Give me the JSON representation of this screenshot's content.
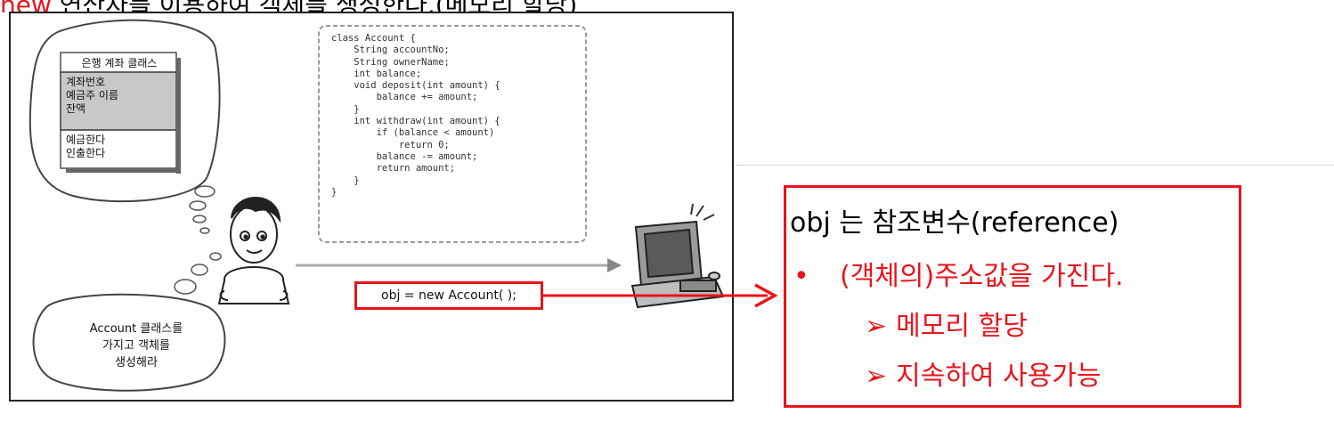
{
  "header_fragment": {
    "lead": "new",
    "rest": " 연산자를 이용하여 객체를 생성한다.(메모리 할당)"
  },
  "figure": {
    "class_box": {
      "title": "은행 계좌 클래스",
      "fields": [
        "계좌번호",
        "예금주 이름",
        "잔액"
      ],
      "methods": [
        "예금한다",
        "인출한다"
      ]
    },
    "code_lines": [
      "class Account {",
      "    String accountNo;",
      "    String ownerName;",
      "    int balance;",
      "    void deposit(int amount) {",
      "        balance += amount;",
      "    }",
      "    int withdraw(int amount) {",
      "        if (balance < amount)",
      "            return 0;",
      "        balance -= amount;",
      "        return amount;",
      "    }",
      "}"
    ],
    "statement": "obj = new Account( );",
    "speech_bubble": [
      "Account 클래스를",
      "가지고 객체를",
      "생성해라"
    ]
  },
  "note": {
    "title": "obj 는 참조변수(reference)",
    "bullet_marker": "•",
    "bullet": "(객체의)주소값을 가진다.",
    "sub_marker": "➢",
    "sub_items": [
      "메모리 할당",
      "지속하여 사용가능"
    ]
  },
  "colors": {
    "accent": "#e8141b",
    "class_fill": "#c8c8c8"
  },
  "icons": [
    "person-figure-icon",
    "computer-monitor-icon"
  ]
}
